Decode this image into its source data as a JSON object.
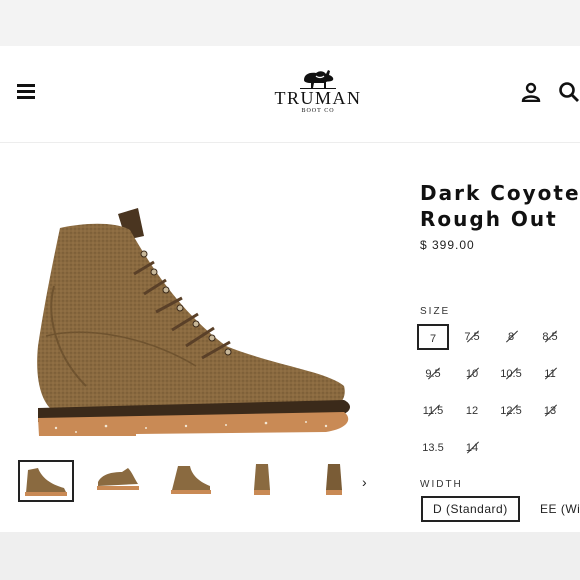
{
  "brand": {
    "name": "TRUMAN",
    "sub": "BOOT CO"
  },
  "header": {
    "menu_icon": "hamburger-icon",
    "account_icon": "account-icon",
    "search_icon": "search-icon"
  },
  "product": {
    "title": "Dark Coyote\nRough Out",
    "price": "$ 399.00"
  },
  "size": {
    "label": "SIZE",
    "options": [
      {
        "label": "7",
        "available": true,
        "selected": true
      },
      {
        "label": "7.5",
        "available": false
      },
      {
        "label": "8",
        "available": false
      },
      {
        "label": "8.5",
        "available": false
      },
      {
        "label": "9.5",
        "available": false
      },
      {
        "label": "10",
        "available": false
      },
      {
        "label": "10.5",
        "available": false
      },
      {
        "label": "11",
        "available": false
      },
      {
        "label": "11.5",
        "available": false
      },
      {
        "label": "12",
        "available": true
      },
      {
        "label": "12.5",
        "available": false
      },
      {
        "label": "13",
        "available": false
      },
      {
        "label": "13.5",
        "available": true
      },
      {
        "label": "14",
        "available": false
      }
    ]
  },
  "width": {
    "label": "WIDTH",
    "options": [
      {
        "label": "D (Standard)",
        "selected": true
      },
      {
        "label": "EE (Wide)"
      }
    ]
  },
  "gallery": {
    "next_icon": "chevron-right-icon",
    "thumbnail_count": 5,
    "active_index": 0
  },
  "colors": {
    "boot_suede": "#8a6a40",
    "boot_dark": "#5e4426",
    "sole": "#c98a55",
    "welt": "#3b2a1a"
  }
}
